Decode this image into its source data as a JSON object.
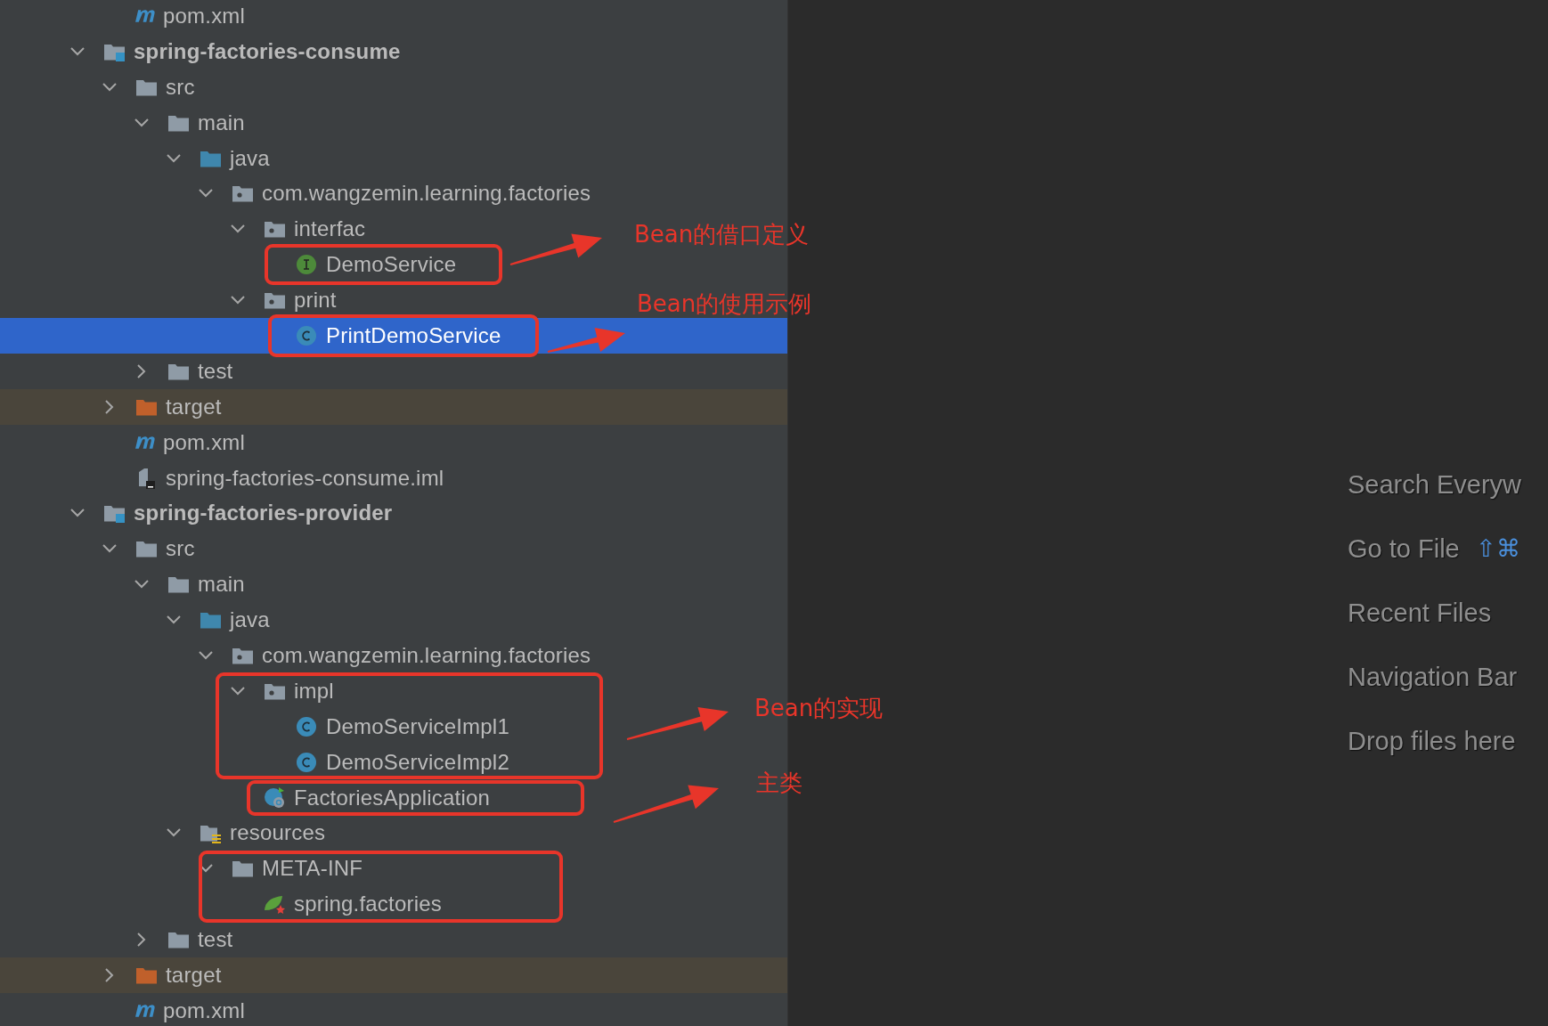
{
  "project_tree": {
    "continued_items": [
      {
        "label": "pom.xml",
        "kind": "maven",
        "selected": false
      }
    ],
    "items": [
      {
        "label": "spring-factories-consume",
        "kind": "module",
        "expanded": true,
        "selected": false,
        "children": [
          {
            "label": "src",
            "kind": "folder",
            "expanded": true,
            "selected": false,
            "children": [
              {
                "label": "main",
                "kind": "folder",
                "expanded": true,
                "selected": false,
                "children": [
                  {
                    "label": "java",
                    "kind": "source-folder",
                    "expanded": true,
                    "selected": false,
                    "children": [
                      {
                        "label": "com.wangzemin.learning.factories",
                        "kind": "package",
                        "expanded": true,
                        "selected": false,
                        "children": [
                          {
                            "label": "interfac",
                            "kind": "package",
                            "expanded": true,
                            "selected": false,
                            "children": [
                              {
                                "label": "DemoService",
                                "kind": "interface",
                                "selected": false
                              }
                            ]
                          },
                          {
                            "label": "print",
                            "kind": "package",
                            "expanded": true,
                            "selected": false,
                            "children": [
                              {
                                "label": "PrintDemoService",
                                "kind": "class",
                                "selected": true
                              }
                            ]
                          }
                        ]
                      }
                    ]
                  }
                ]
              },
              {
                "label": "test",
                "kind": "folder",
                "expanded": false,
                "selected": false
              }
            ]
          },
          {
            "label": "target",
            "kind": "excluded-folder",
            "expanded": false,
            "selected": false
          },
          {
            "label": "pom.xml",
            "kind": "maven",
            "selected": false
          },
          {
            "label": "spring-factories-consume.iml",
            "kind": "iml",
            "selected": false
          }
        ]
      },
      {
        "label": "spring-factories-provider",
        "kind": "module",
        "expanded": true,
        "selected": false,
        "children": [
          {
            "label": "src",
            "kind": "folder",
            "expanded": true,
            "selected": false,
            "children": [
              {
                "label": "main",
                "kind": "folder",
                "expanded": true,
                "selected": false,
                "children": [
                  {
                    "label": "java",
                    "kind": "source-folder",
                    "expanded": true,
                    "selected": false,
                    "children": [
                      {
                        "label": "com.wangzemin.learning.factories",
                        "kind": "package",
                        "expanded": true,
                        "selected": false,
                        "children": [
                          {
                            "label": "impl",
                            "kind": "package",
                            "expanded": true,
                            "selected": false,
                            "children": [
                              {
                                "label": "DemoServiceImpl1",
                                "kind": "class",
                                "selected": false
                              },
                              {
                                "label": "DemoServiceImpl2",
                                "kind": "class",
                                "selected": false
                              }
                            ]
                          },
                          {
                            "label": "FactoriesApplication",
                            "kind": "app-class",
                            "selected": false
                          }
                        ]
                      }
                    ]
                  },
                  {
                    "label": "resources",
                    "kind": "resources-folder",
                    "expanded": true,
                    "selected": false,
                    "children": [
                      {
                        "label": "META-INF",
                        "kind": "folder",
                        "expanded": true,
                        "selected": false,
                        "children": [
                          {
                            "label": "spring.factories",
                            "kind": "spring-config",
                            "selected": false
                          }
                        ]
                      }
                    ]
                  }
                ]
              },
              {
                "label": "test",
                "kind": "folder",
                "expanded": false,
                "selected": false
              }
            ]
          },
          {
            "label": "target",
            "kind": "excluded-folder",
            "expanded": false,
            "selected": false
          },
          {
            "label": "pom.xml",
            "kind": "maven",
            "selected": false
          }
        ]
      }
    ]
  },
  "welcome_hints": [
    {
      "label": "Search Everyw"
    },
    {
      "label": "Go to File",
      "shortcut": "⇧⌘"
    },
    {
      "label": "Recent Files"
    },
    {
      "label": "Navigation Bar"
    },
    {
      "label": "Drop files here"
    }
  ],
  "annotations": [
    {
      "text": "Bean的借口定义"
    },
    {
      "text": "Bean的使用示例"
    },
    {
      "text": "Bean的实现"
    },
    {
      "text": "主类"
    }
  ]
}
